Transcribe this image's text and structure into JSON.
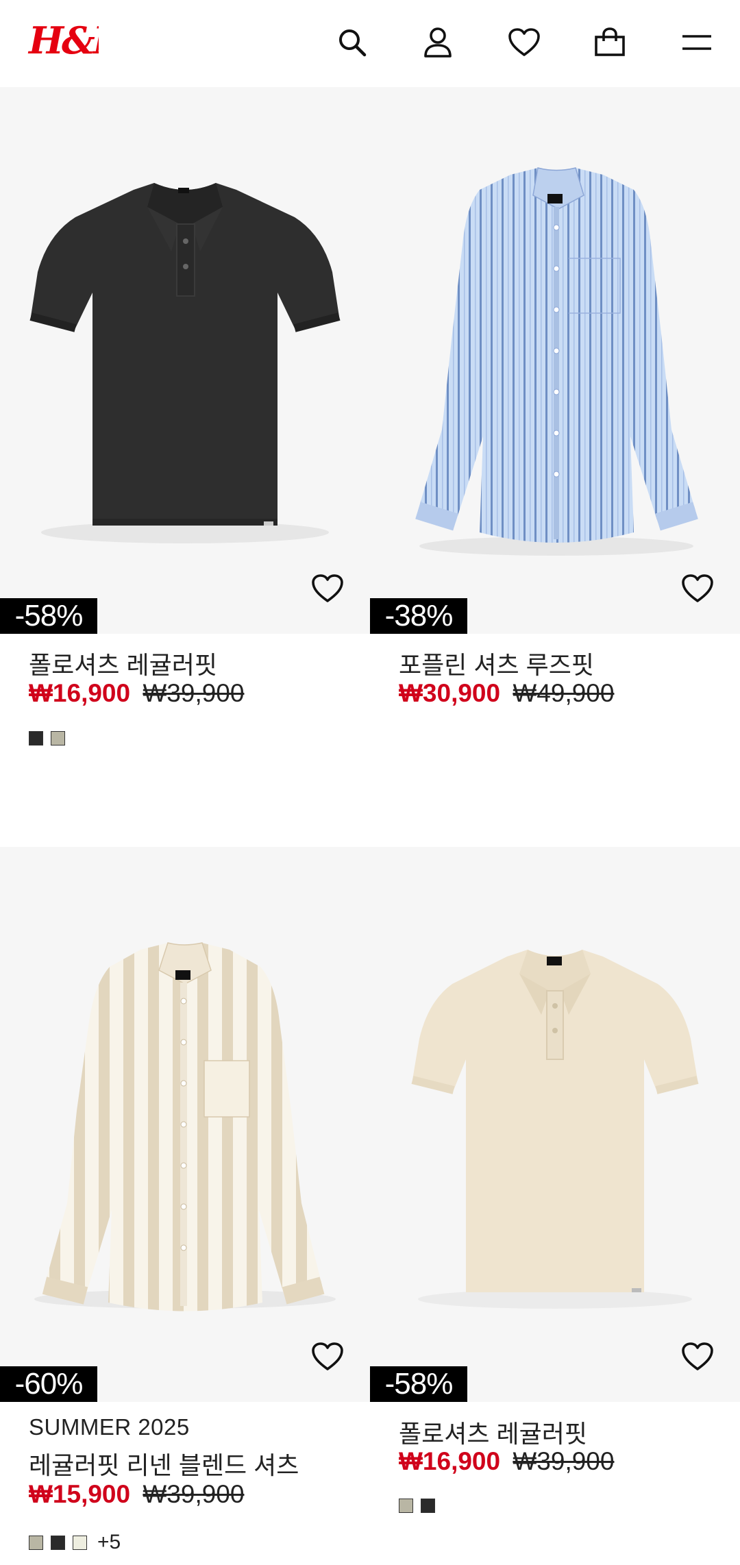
{
  "header": {
    "logo_text": "H&M",
    "icons": [
      "search-icon",
      "account-icon",
      "favorites-icon",
      "shopping-bag-icon",
      "menu-icon"
    ]
  },
  "products": [
    {
      "image": "black polo shirt",
      "discount": "-58%",
      "tag": "",
      "name": "폴로셔츠 레귤러핏",
      "price": "₩16,900",
      "old_price": "₩39,900",
      "swatches": [
        "#2a2a2a",
        "#b9b6a4"
      ],
      "more": ""
    },
    {
      "image": "light blue striped shirt",
      "discount": "-38%",
      "tag": "",
      "name": "포플린 셔츠 루즈핏",
      "price": "₩30,900",
      "old_price": "₩49,900",
      "swatches": [],
      "more": ""
    },
    {
      "image": "beige striped linen shirt",
      "discount": "-60%",
      "tag": "SUMMER 2025",
      "name": "레귤러핏 리넨 블렌드 셔츠",
      "price": "₩15,900",
      "old_price": "₩39,900",
      "swatches": [
        "#b9b6a4",
        "#2a2a2a",
        "#eeeee0"
      ],
      "more": "+5"
    },
    {
      "image": "cream polo shirt",
      "discount": "-58%",
      "tag": "",
      "name": "폴로셔츠 레귤러핏",
      "price": "₩16,900",
      "old_price": "₩39,900",
      "swatches": [
        "#b9b6a4",
        "#2a2a2a"
      ],
      "more": ""
    }
  ],
  "colors": {
    "sale_price": "#d0021b",
    "logo": "#e50010",
    "image_background": "#f6f6f6"
  }
}
